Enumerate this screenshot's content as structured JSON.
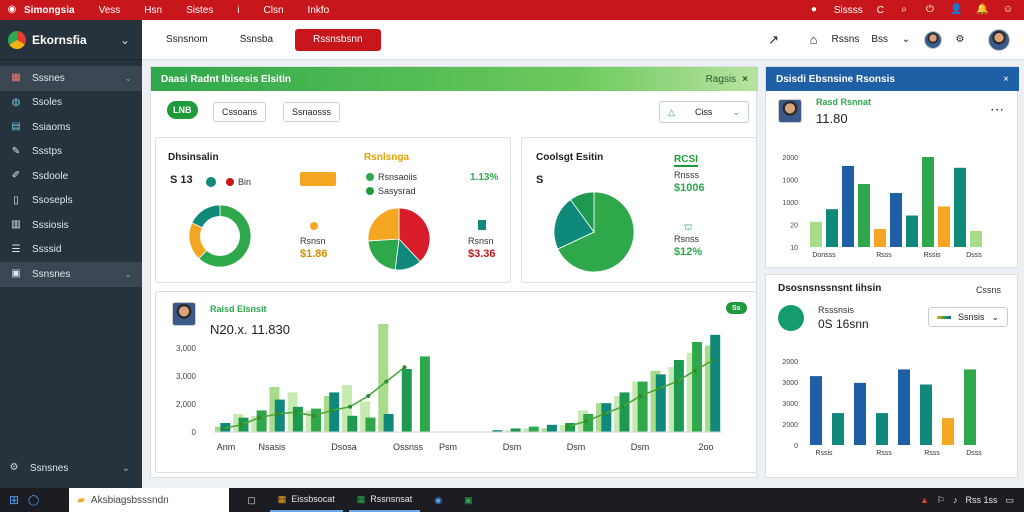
{
  "topbar": {
    "app_name": "Simongsia",
    "menu": [
      "Vess",
      "Hsn",
      "Sistes",
      "i",
      "Clsn",
      "Inkfo"
    ],
    "right_label": "Sissss",
    "right_letter": "C"
  },
  "sidebar": {
    "brand": "Ekornsfia",
    "items": [
      {
        "label": "Sssnes",
        "icon": "grid-icon",
        "chevron": true,
        "active": true
      },
      {
        "label": "Ssoles",
        "icon": "globe-icon",
        "chevron": false,
        "active": false
      },
      {
        "label": "Ssiaoms",
        "icon": "layers-icon",
        "chevron": false,
        "active": false
      },
      {
        "label": "Ssstps",
        "icon": "tools-icon",
        "chevron": false,
        "active": false
      },
      {
        "label": "Ssdoole",
        "icon": "pen-icon",
        "chevron": false,
        "active": false
      },
      {
        "label": "Ssosepls",
        "icon": "doc-icon",
        "chevron": false,
        "active": false
      },
      {
        "label": "Sssiosis",
        "icon": "table-icon",
        "chevron": false,
        "active": false
      },
      {
        "label": "Ssssid",
        "icon": "list-icon",
        "chevron": false,
        "active": false
      },
      {
        "label": "Ssnsnes",
        "icon": "menu-icon",
        "chevron": true,
        "active": false
      }
    ],
    "bottom_label": "Ssnsnes"
  },
  "header": {
    "tab1": "Ssnsnom",
    "tab2": "Ssnsba",
    "primary_button": "Rssnsbsnn",
    "home_label": "Rssns",
    "user_label": "Bss"
  },
  "colors": {
    "red": "#c8161d",
    "green": "#2ea84a",
    "blue": "#1f5fa6",
    "teal": "#0f8a7a",
    "orange": "#f5a623",
    "light_green": "#a8dc8a"
  },
  "main_panel": {
    "title": "Daasi Radnt Ibisesis Elsitin",
    "title_right": "Ragsis",
    "badge": "LNB",
    "pill1": "Cssoans",
    "pill2": "Ssnaosss",
    "action": "Ciss",
    "card1": {
      "title": "Dhsinsalin",
      "value": "S 13",
      "legend": "Bin",
      "center_title": "Rsnlsnga",
      "legend_a": "Rsnsaoiis",
      "legend_a_value": "1.13%",
      "legend_b": "Sasysrad",
      "left_label": "Rsnsn",
      "left_value": "$1.86",
      "right_label": "Rsnsn",
      "right_value": "$3.36"
    },
    "card2": {
      "title": "Coolsgt Esitin",
      "value": "S",
      "badge": "RCSI",
      "label1": "Rnsss",
      "value1": "$1006",
      "label2": "Rsnss",
      "value2": "$12%"
    },
    "card3": {
      "title": "Raisd Elsnsit",
      "value": "N20.x. 11.830",
      "chip": "Ss"
    }
  },
  "blue_panel": {
    "title": "Dsisdi Ebsnsine Rsonsis",
    "person_title": "Rasd Rsnnat",
    "person_value": "11.80"
  },
  "white_panel": {
    "title": "Dsosnsnssnsnt Iihsin",
    "title_right": "Cssns",
    "label": "Rsssnsis",
    "value": "0S 16snn",
    "select": "Ssnsis"
  },
  "taskbar": {
    "search": "Aksbiagsbsssndn",
    "task1": "Eissbsocat",
    "task2": "Rssnsnsat",
    "time": "Rss 1ss"
  },
  "chart_data": [
    {
      "type": "pie",
      "name": "card1-donut",
      "values": [
        62,
        20,
        18
      ],
      "colors": [
        "#2ea84a",
        "#f5a623",
        "#0f8a7a"
      ]
    },
    {
      "type": "pie",
      "name": "card1-pie",
      "values": [
        38,
        14,
        22,
        26
      ],
      "colors": [
        "#d71d2a",
        "#0f8a7a",
        "#2ea84a",
        "#f5a623"
      ]
    },
    {
      "type": "pie",
      "name": "card2-pie",
      "values": [
        68,
        22,
        10
      ],
      "colors": [
        "#2ea84a",
        "#0f8a7a",
        "#1d9a4f"
      ]
    },
    {
      "type": "bar",
      "name": "main-combo",
      "yticks": [
        "0",
        "2,000",
        "3,000",
        "3,000"
      ],
      "xticks": [
        "Anm",
        "Nsasis",
        "Dsosa",
        "Ossnss",
        "Psm",
        "Dsm",
        "Dsm",
        "Dsm",
        "2oo"
      ],
      "series": [
        {
          "values": [
            5,
            8,
            12,
            18,
            14,
            13,
            22,
            9,
            8,
            10,
            35,
            42,
            0,
            0,
            0,
            1,
            2,
            3,
            4,
            5,
            10,
            16,
            22,
            28,
            32,
            40,
            50,
            54
          ]
        },
        {
          "values": [
            3,
            10,
            9,
            25,
            22,
            12,
            20,
            26,
            17,
            60,
            0,
            0,
            0,
            0,
            0,
            0,
            1,
            2,
            2,
            4,
            12,
            16,
            20,
            28,
            34,
            36,
            44,
            48
          ]
        }
      ],
      "line": [
        2,
        4,
        8,
        10,
        11,
        9,
        12,
        14,
        20,
        28,
        36,
        0,
        0,
        0,
        0,
        0,
        0,
        0,
        0,
        3,
        6,
        10,
        14,
        20,
        24,
        28,
        34,
        40
      ]
    },
    {
      "type": "bar",
      "name": "blue-panel-bars",
      "yticks": [
        "10",
        "20",
        "1000",
        "1000",
        "2000"
      ],
      "xticks": [
        "Donsss",
        "Rsss",
        "Rssis",
        "Dsss"
      ],
      "values": [
        {
          "x": 0,
          "h": 28,
          "c": "#a8dc8a"
        },
        {
          "x": 1,
          "h": 42,
          "c": "#0f8a7a"
        },
        {
          "x": 2,
          "h": 90,
          "c": "#1f5fa6"
        },
        {
          "x": 3,
          "h": 70,
          "c": "#2ea84a"
        },
        {
          "x": 4,
          "h": 20,
          "c": "#f5a623"
        },
        {
          "x": 5,
          "h": 60,
          "c": "#1f5fa6"
        },
        {
          "x": 6,
          "h": 35,
          "c": "#0f8a7a"
        },
        {
          "x": 7,
          "h": 100,
          "c": "#2ea84a"
        },
        {
          "x": 8,
          "h": 45,
          "c": "#f5a623"
        },
        {
          "x": 9,
          "h": 88,
          "c": "#0f8a7a"
        },
        {
          "x": 10,
          "h": 18,
          "c": "#a8dc8a"
        }
      ]
    },
    {
      "type": "bar",
      "name": "white-panel-bars",
      "yticks": [
        "0",
        "2000",
        "3000",
        "3000",
        "2000"
      ],
      "xticks": [
        "Rssis",
        "Rsss",
        "Rsss",
        "Dsss"
      ],
      "values": [
        {
          "x": 0,
          "h": 82,
          "c": "#1f5fa6"
        },
        {
          "x": 1,
          "h": 38,
          "c": "#0f8a7a"
        },
        {
          "x": 2,
          "h": 74,
          "c": "#1f5fa6"
        },
        {
          "x": 3,
          "h": 38,
          "c": "#0f8a7a"
        },
        {
          "x": 4,
          "h": 90,
          "c": "#1f5fa6"
        },
        {
          "x": 5,
          "h": 72,
          "c": "#0f8a7a"
        },
        {
          "x": 6,
          "h": 32,
          "c": "#f5a623"
        },
        {
          "x": 7,
          "h": 90,
          "c": "#2ea84a"
        }
      ]
    }
  ]
}
